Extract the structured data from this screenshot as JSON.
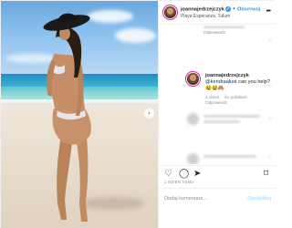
{
  "header": {
    "username": "joannajedrzejczyk",
    "follow_label": "Obserwuj",
    "location": "Playa Esperanza, Tulum",
    "more_icon": "ellipsis-icon"
  },
  "comments": {
    "reply_top": "Odpowiedz",
    "main": {
      "username": "joannajedrzejczyk",
      "mention": "@kendraalust",
      "text": "can you help?",
      "emoji": "😆😆🙈",
      "time": "1 dzień",
      "likes": "31 polubień",
      "reply": "Odpowiedz"
    }
  },
  "actions": {
    "like_icon": "heart-icon",
    "comment_icon": "comment-icon",
    "share_icon": "share-icon",
    "save_icon": "bookmark-icon",
    "date": "1 DZIEŃ TEMU"
  },
  "add_comment": {
    "placeholder": "Dodaj komentarz...",
    "publish": "Opublikuj"
  },
  "colors": {
    "accent": "#3897f0",
    "border": "#efefef",
    "muted": "#8e8e8e"
  }
}
